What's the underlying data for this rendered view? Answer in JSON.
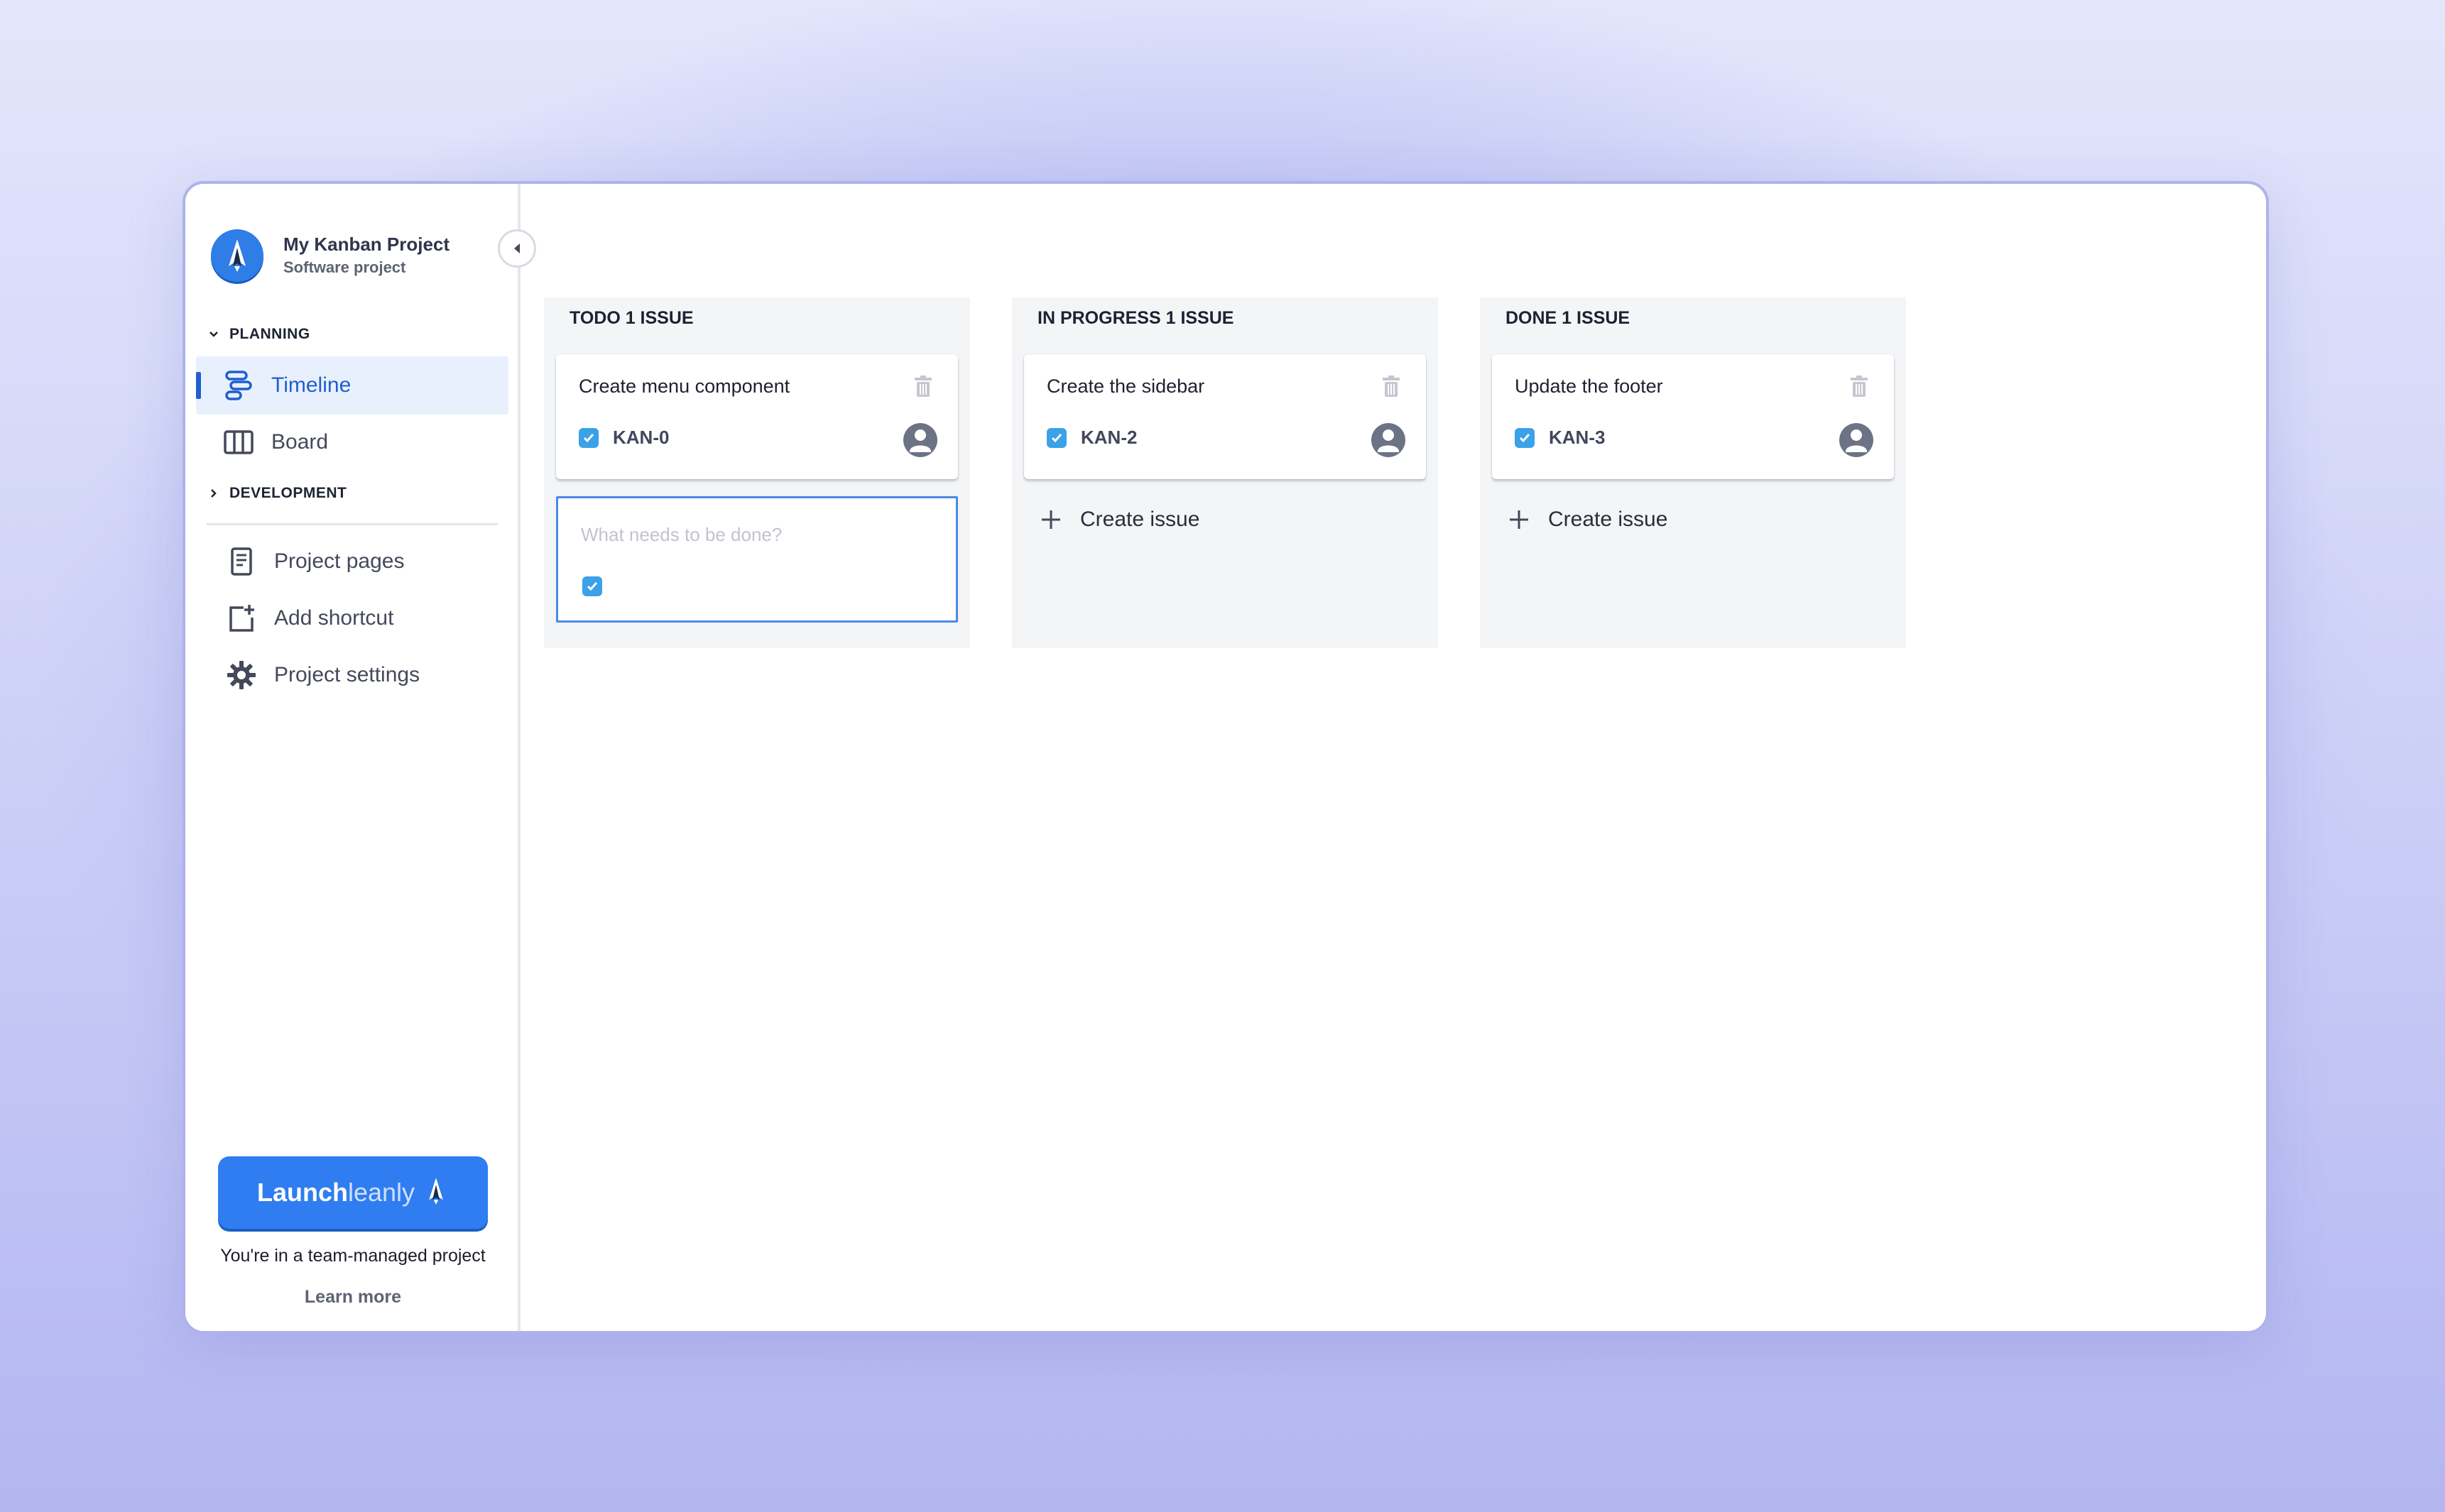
{
  "project": {
    "name": "My Kanban Project",
    "type": "Software project",
    "logo_icon": "rocket-icon"
  },
  "sidebar": {
    "sections": [
      {
        "label": "PLANNING",
        "expanded": true
      },
      {
        "label": "DEVELOPMENT",
        "expanded": false
      }
    ],
    "planning_items": [
      {
        "label": "Timeline",
        "icon": "timeline-icon",
        "active": true
      },
      {
        "label": "Board",
        "icon": "board-icon",
        "active": false
      }
    ],
    "other_items": [
      {
        "label": "Project pages",
        "icon": "page-icon"
      },
      {
        "label": "Add shortcut",
        "icon": "add-shortcut-icon"
      },
      {
        "label": "Project settings",
        "icon": "gear-icon"
      }
    ],
    "promo": {
      "brand_bold": "Launch",
      "brand_light": "leanly",
      "message": "You're in a team-managed project",
      "link": "Learn more"
    }
  },
  "board": {
    "columns": [
      {
        "title": "TODO 1 ISSUE",
        "cards": [
          {
            "title": "Create menu component",
            "key": "KAN-0"
          }
        ],
        "create_placeholder": "What needs to be done?"
      },
      {
        "title": "IN PROGRESS 1 ISSUE",
        "cards": [
          {
            "title": "Create the sidebar",
            "key": "KAN-2"
          }
        ],
        "create_label": "Create issue"
      },
      {
        "title": "DONE 1 ISSUE",
        "cards": [
          {
            "title": "Update the footer",
            "key": "KAN-3"
          }
        ],
        "create_label": "Create issue"
      }
    ]
  },
  "colors": {
    "accent": "#1f5fcf",
    "checkbox": "#3ba1e8",
    "promo": "#2f7df0",
    "column_bg": "#f4f5f7"
  }
}
